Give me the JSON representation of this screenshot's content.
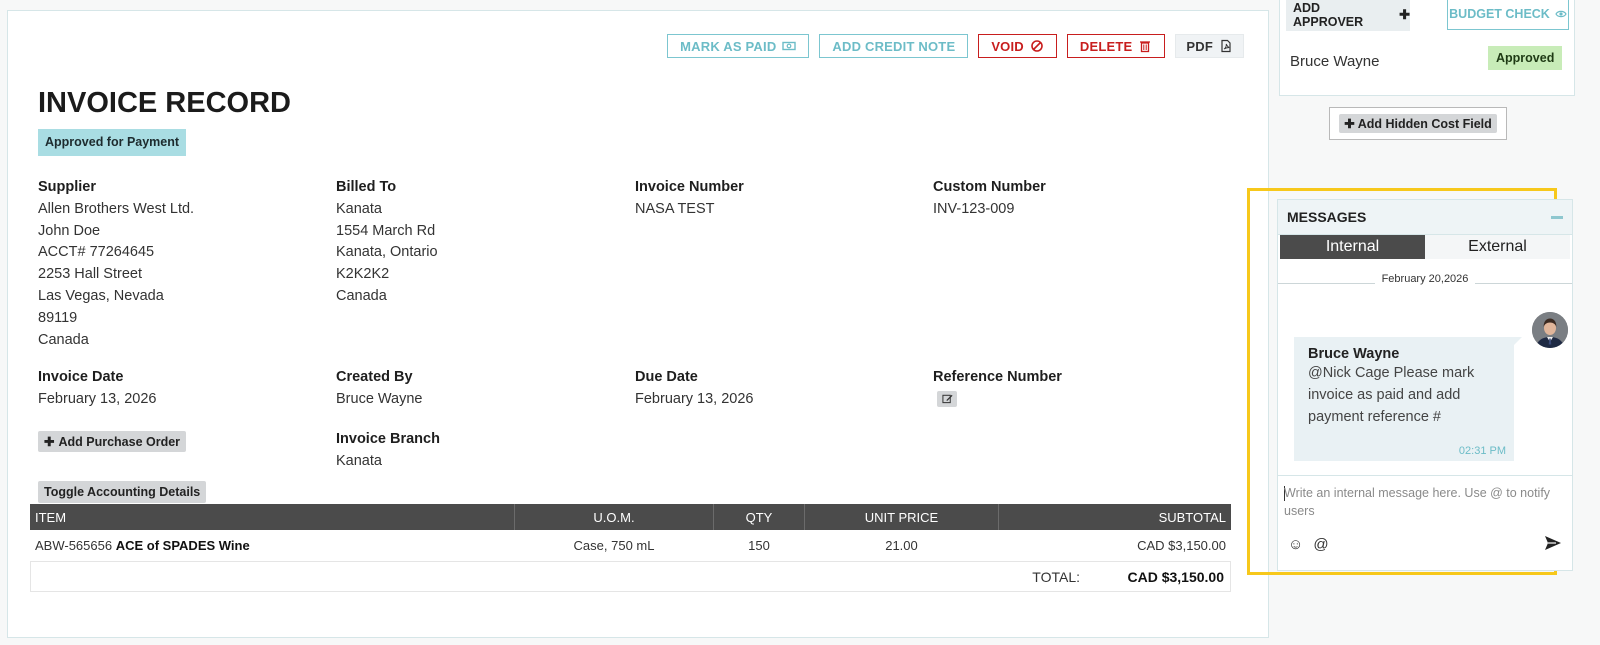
{
  "toolbar": {
    "mark_as_paid": "MARK AS PAID",
    "add_credit_note": "ADD CREDIT NOTE",
    "void": "VOID",
    "delete": "DELETE",
    "pdf": "PDF"
  },
  "invoice": {
    "title": "INVOICE RECORD",
    "status": "Approved for Payment",
    "supplier": {
      "label": "Supplier",
      "lines": [
        "Allen Brothers West Ltd.",
        "John Doe",
        "ACCT# 77264645",
        "2253 Hall Street",
        "Las Vegas, Nevada",
        "89119",
        "Canada"
      ]
    },
    "billed_to": {
      "label": "Billed To",
      "lines": [
        "Kanata",
        "1554 March Rd",
        "Kanata, Ontario",
        "K2K2K2",
        "Canada"
      ]
    },
    "invoice_number": {
      "label": "Invoice Number",
      "value": "NASA TEST"
    },
    "custom_number": {
      "label": "Custom Number",
      "value": "INV-123-009"
    },
    "invoice_date": {
      "label": "Invoice Date",
      "value": "February 13, 2026"
    },
    "created_by": {
      "label": "Created By",
      "value": "Bruce Wayne"
    },
    "due_date": {
      "label": "Due Date",
      "value": "February 13, 2026"
    },
    "reference_number": {
      "label": "Reference Number"
    },
    "invoice_branch": {
      "label": "Invoice Branch",
      "value": "Kanata"
    },
    "add_purchase_order": "Add Purchase Order",
    "toggle_accounting": "Toggle Accounting Details"
  },
  "table": {
    "headers": {
      "item": "ITEM",
      "uom": "U.O.M.",
      "qty": "QTY",
      "unit_price": "UNIT PRICE",
      "subtotal": "SUBTOTAL"
    },
    "rows": [
      {
        "code": "ABW-565656",
        "name": "ACE of SPADES Wine",
        "uom": "Case, 750 mL",
        "qty": "150",
        "unit_price": "21.00",
        "subtotal": "CAD $3,150.00"
      }
    ],
    "total_label": "TOTAL:",
    "total_value": "CAD $3,150.00"
  },
  "approval": {
    "add_approver": "ADD APPROVER",
    "budget_check": "BUDGET CHECK",
    "approver_name": "Bruce Wayne",
    "approver_status": "Approved",
    "add_hidden_cost": "Add Hidden Cost Field"
  },
  "messages": {
    "title": "MESSAGES",
    "tab_internal": "Internal",
    "tab_external": "External",
    "date": "February 20,2026",
    "message": {
      "author": "Bruce Wayne",
      "text": "@Nick Cage Please mark invoice as paid and add payment reference #",
      "time": "02:31 PM"
    },
    "composer_placeholder": "Write an internal message here. Use @ to notify users",
    "mention_symbol": "@"
  },
  "colors": {
    "accent_teal": "#6cbcc7",
    "danger_red": "#c81e1e",
    "highlight_yellow": "#f7c81b",
    "header_dark": "#4b4b4b"
  }
}
